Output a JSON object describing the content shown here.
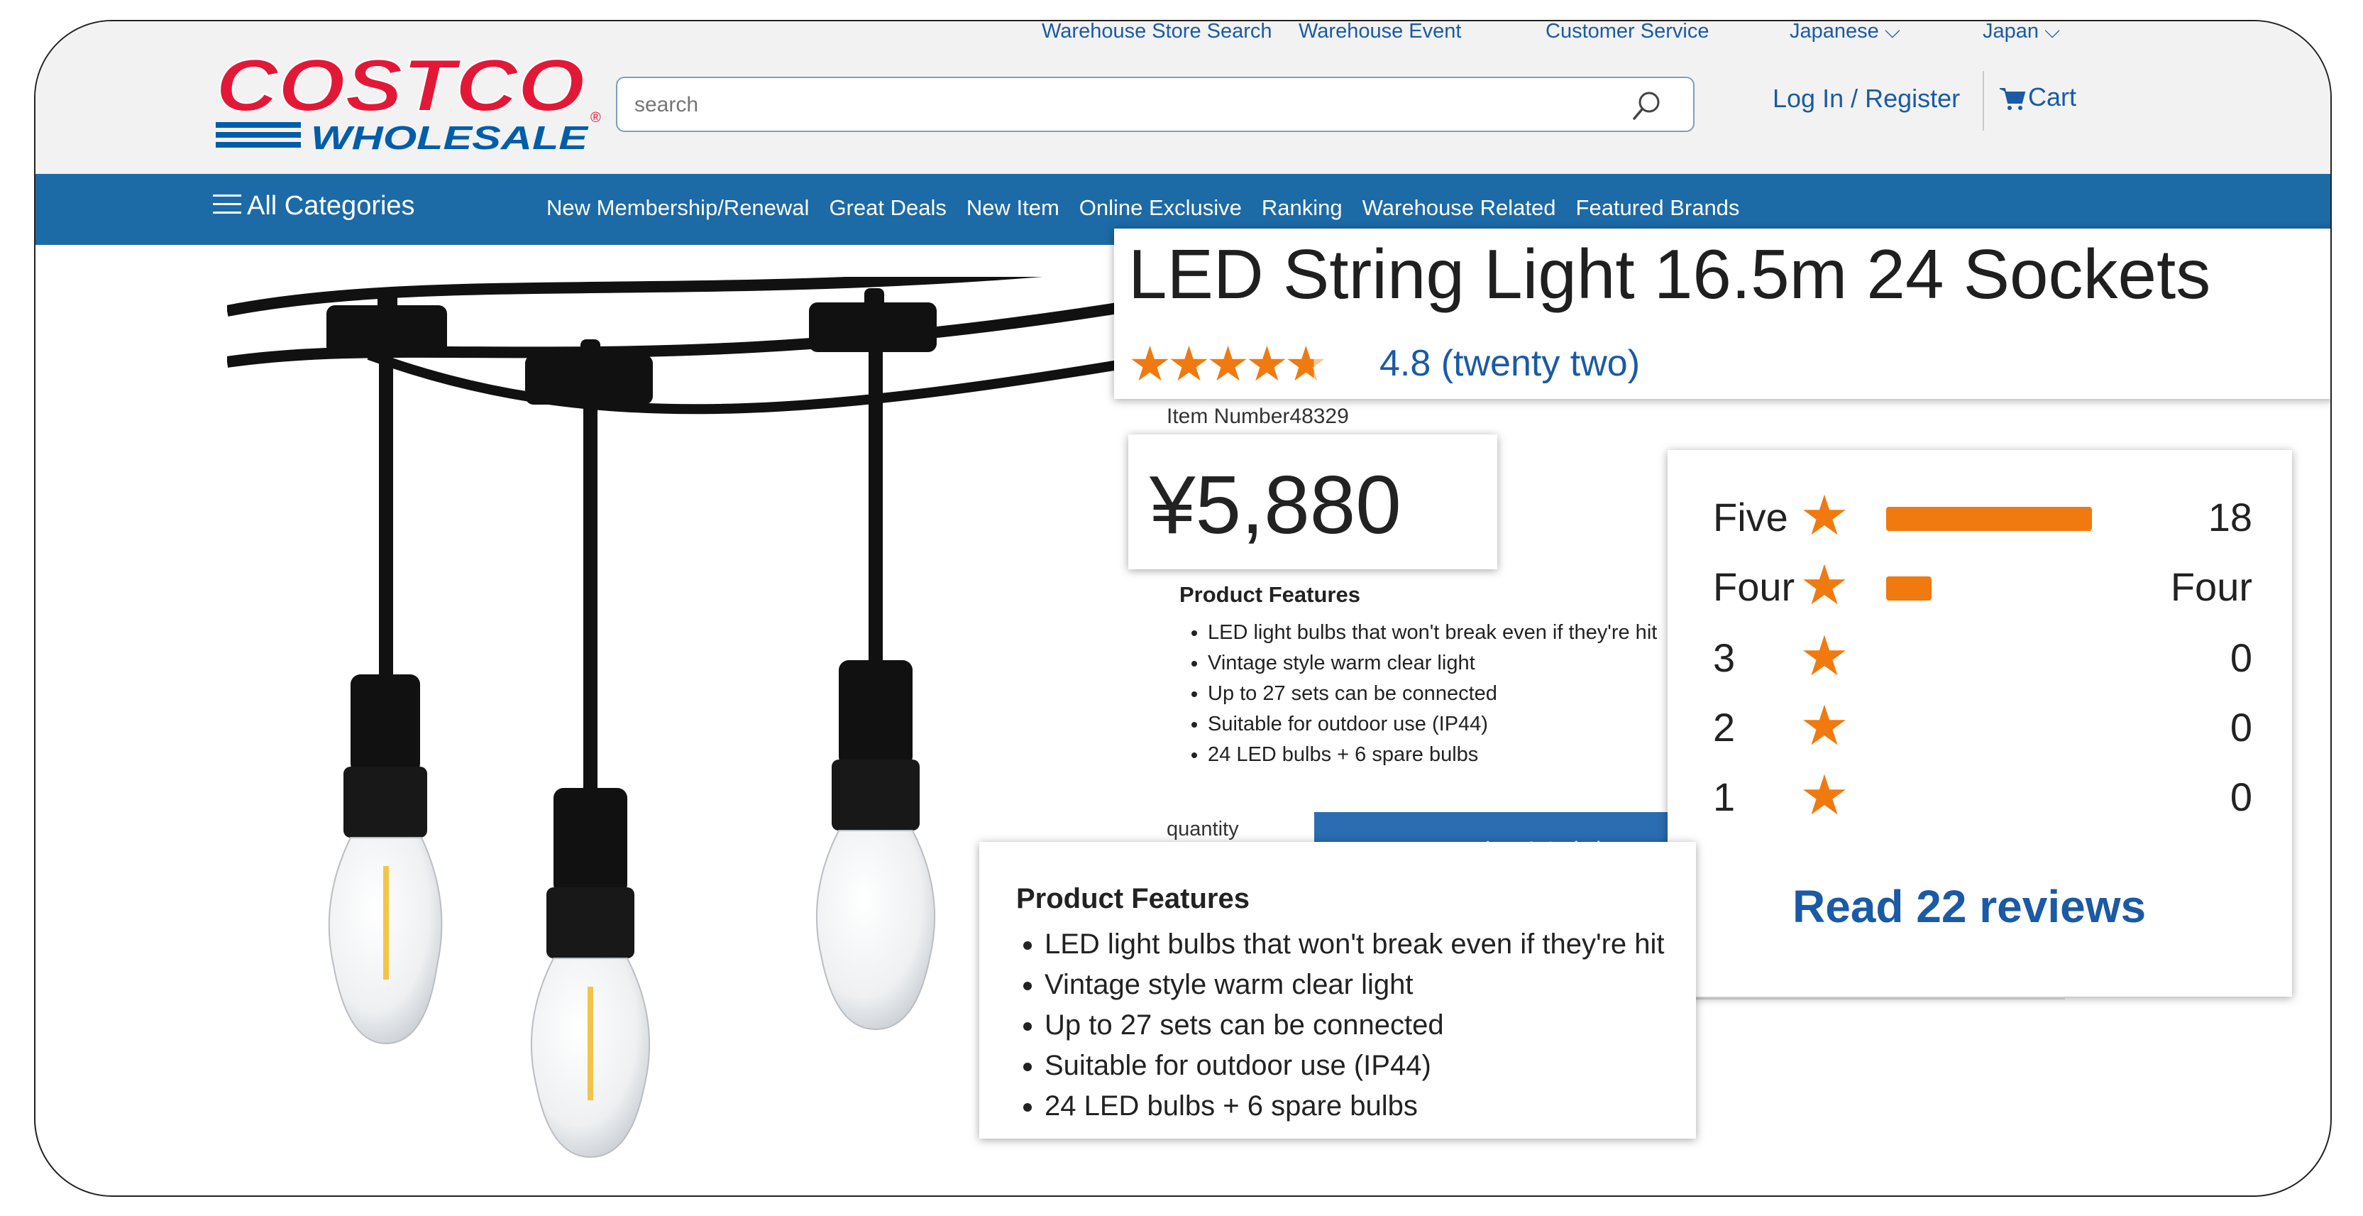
{
  "header": {
    "logo_top": "COSTCO",
    "logo_bottom": "WHOLESALE",
    "util_links": [
      "Warehouse Store Search",
      "Warehouse Event",
      "Customer Service",
      "Japanese",
      "Japan"
    ],
    "search_placeholder": "search",
    "login_label": "Log In / Register",
    "cart_label": "Cart"
  },
  "nav": {
    "all_categories": "All Categories",
    "links": [
      "New Membership/Renewal",
      "Great Deals",
      "New Item",
      "Online Exclusive",
      "Ranking",
      "Warehouse Related",
      "Featured Brands"
    ]
  },
  "product": {
    "title": "LED String Light 16.5m 24 Sockets",
    "rating_value": 4.8,
    "rating_text": "4.8 (twenty two)",
    "item_number": "Item Number48329",
    "price": "¥5,880",
    "features_heading": "Product Features",
    "features": [
      "LED light bulbs that won't break even if they're hit",
      "Vintage style warm clear light",
      "Up to 27 sets can be connected",
      "Suitable for outdoor use (IP44)",
      "24 LED bulbs + 6 spare bulbs"
    ],
    "quantity_label": "quantity",
    "add_to_cart_label": "カートに入れる"
  },
  "reviews": {
    "rows": [
      {
        "label": "Five",
        "count": "18",
        "fraction": 0.82
      },
      {
        "label": "Four",
        "count": "Four",
        "fraction": 0.18
      },
      {
        "label": "3",
        "count": "0",
        "fraction": 0
      },
      {
        "label": "2",
        "count": "0",
        "fraction": 0
      },
      {
        "label": "1",
        "count": "0",
        "fraction": 0
      }
    ],
    "read_reviews_label": "Read 22 reviews"
  },
  "colors": {
    "brand_red": "#e31837",
    "brand_blue": "#005daa",
    "nav_blue": "#1c6aa6",
    "star_orange": "#f07a10",
    "link_blue": "#1a5aa6"
  }
}
